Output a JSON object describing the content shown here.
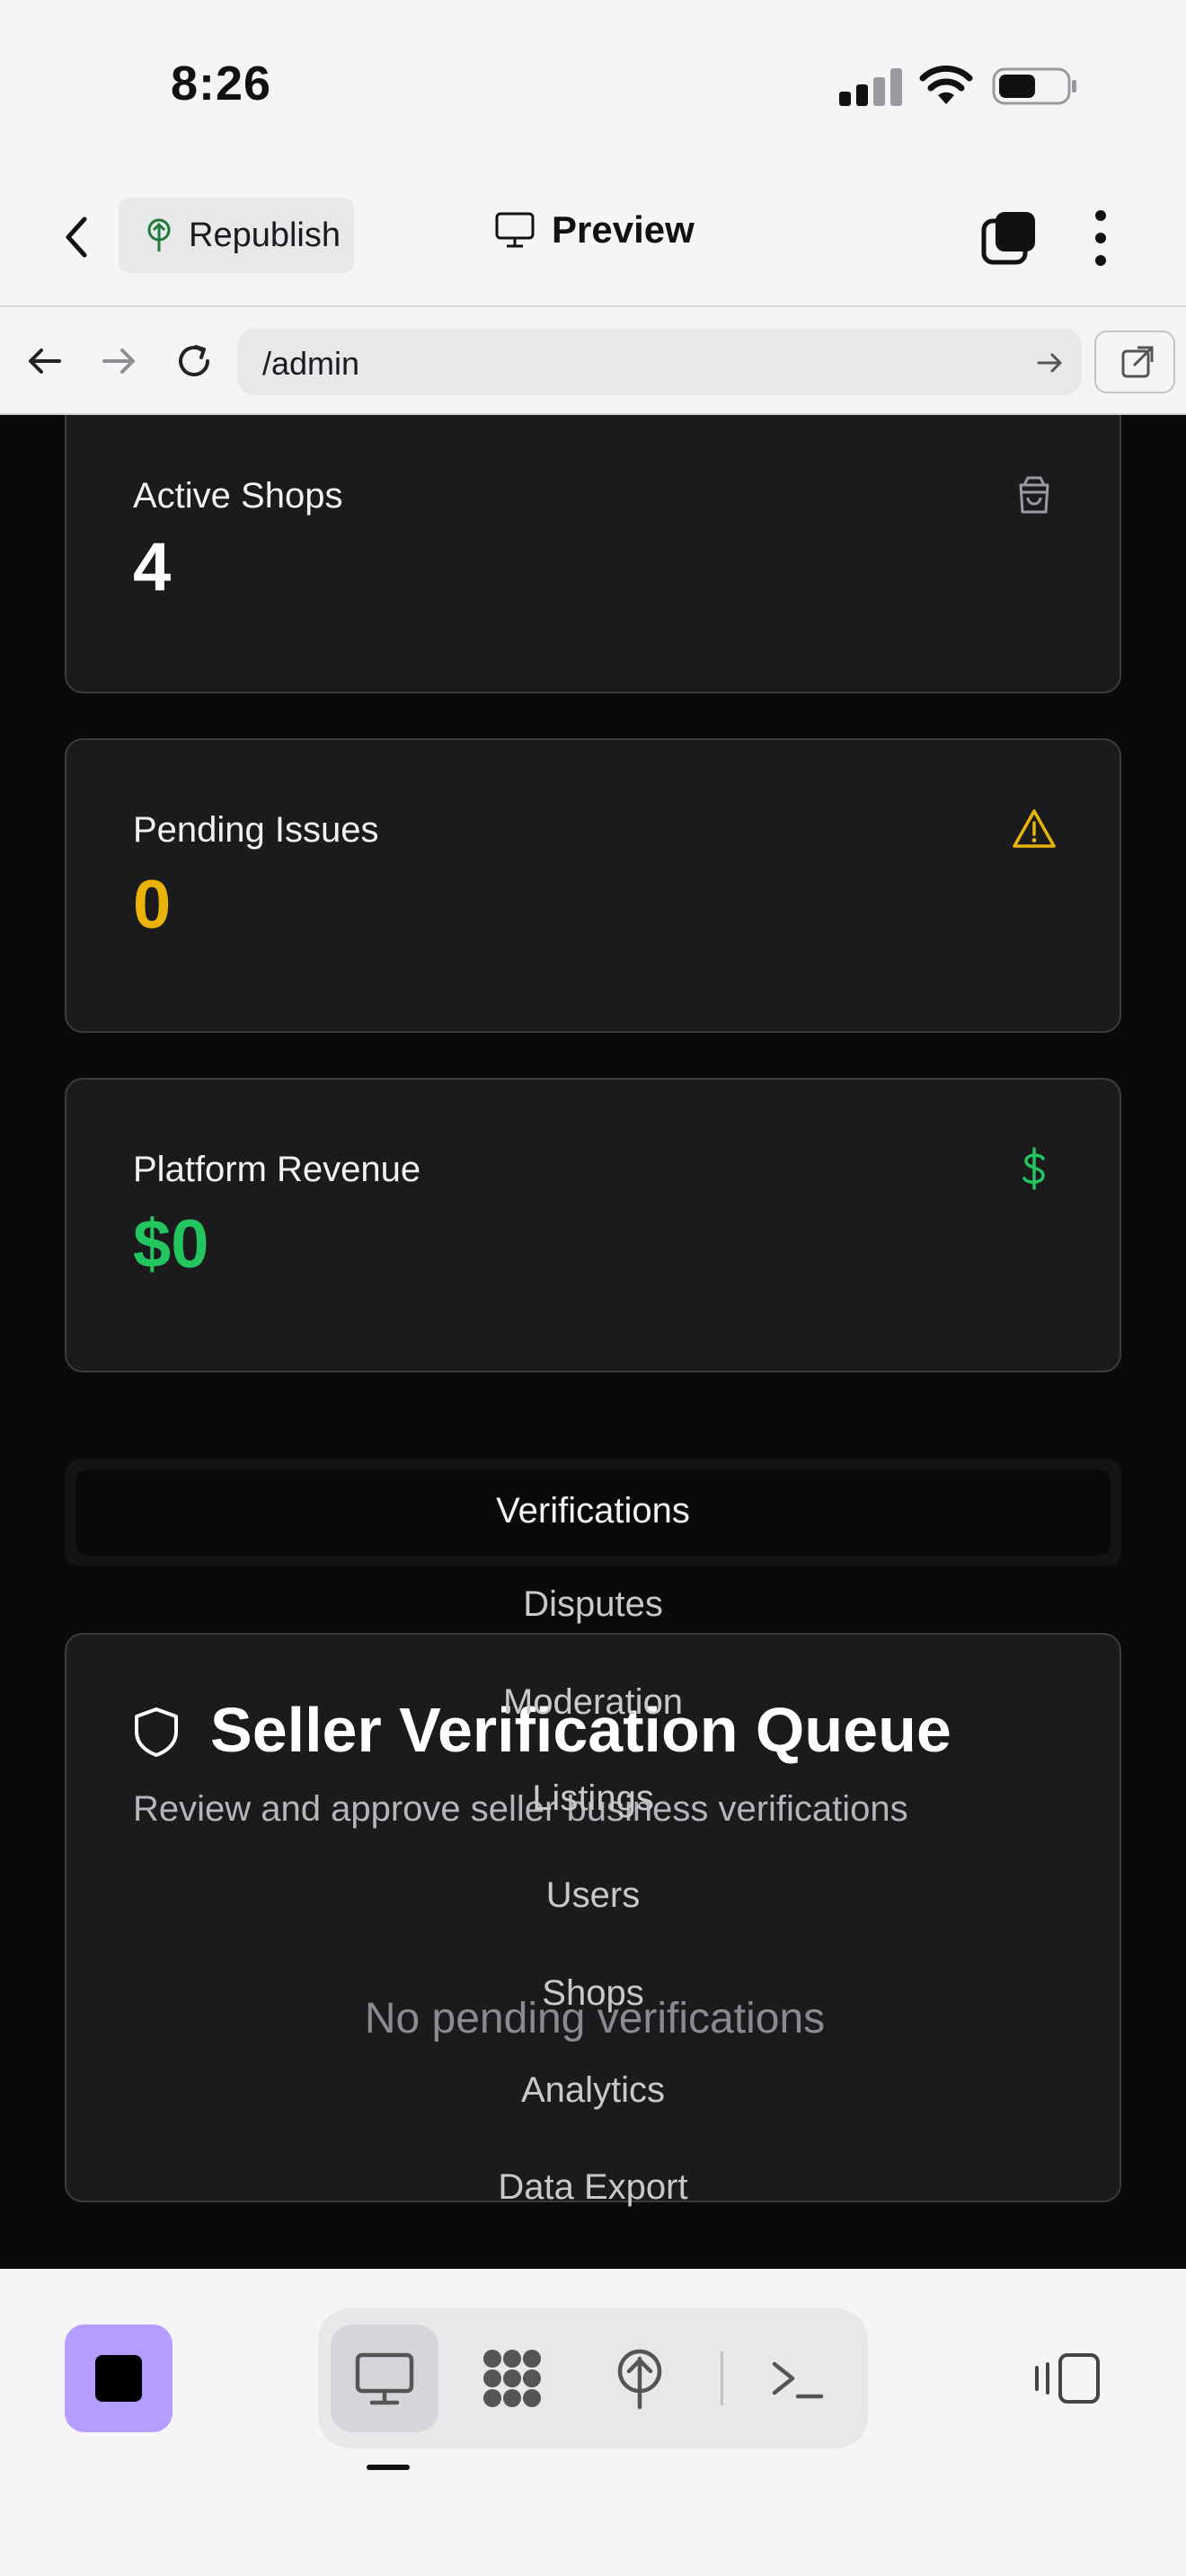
{
  "status_bar": {
    "time": "8:26"
  },
  "top_bar": {
    "republish_label": "Republish",
    "preview_label": "Preview"
  },
  "browser": {
    "url": "/admin"
  },
  "stats": [
    {
      "label": "Active Shops",
      "value": "4",
      "color": "#ffffff",
      "icon": "shopping-bag-icon"
    },
    {
      "label": "Pending Issues",
      "value": "0",
      "color": "#eab308",
      "icon": "warning-icon"
    },
    {
      "label": "Platform Revenue",
      "value": "$0",
      "color": "#22c55e",
      "icon": "dollar-icon"
    }
  ],
  "tabs": {
    "active": "Verifications",
    "items": [
      "Disputes",
      "Moderation",
      "Listings",
      "Users",
      "Shops",
      "Analytics",
      "Data Export"
    ]
  },
  "verification_queue": {
    "title": "Seller Verification Queue",
    "description": "Review and approve seller business verifications",
    "empty_message": "No pending verifications"
  },
  "colors": {
    "accent_purple": "#b59cff",
    "warning": "#eab308",
    "success": "#22c55e"
  }
}
